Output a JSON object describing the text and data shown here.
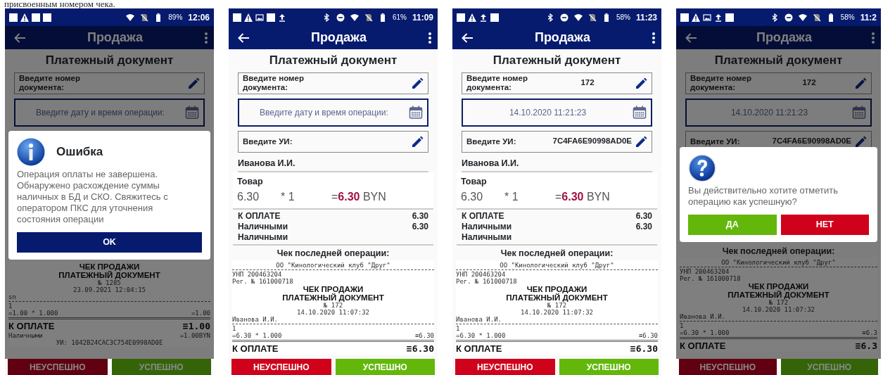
{
  "caption": "присвоенным номером чека.",
  "phones": [
    {
      "dimmed": true,
      "status_bar": {
        "left_icons": [
          {
            "kind": "square"
          },
          {
            "kind": "warning"
          },
          {
            "kind": "square"
          },
          {
            "kind": "square"
          }
        ],
        "right_icons": [
          {
            "kind": "wifi"
          },
          {
            "kind": "nosim"
          },
          {
            "kind": "battery"
          }
        ],
        "battery": "89%",
        "time": "12:06"
      },
      "app_bar": {
        "title": "Продажа"
      },
      "content": [
        {
          "kind": "heading",
          "text": "Платежный документ"
        },
        {
          "kind": "text_field",
          "label": "Введите номер документа:"
        },
        {
          "kind": "date_field",
          "placeholder": "Введите дату и время операции:"
        },
        {
          "kind": "error_dialog",
          "title": "Ошибка",
          "message": "Операция оплаты не завершена. Обнаружено расхождение суммы наличных в БД и СКО. Свяжитесь с оператором ПКС для уточнения состояния операции",
          "buttons": [
            {
              "label": "OK",
              "color": "#061a6e"
            }
          ]
        },
        {
          "kind": "receipt",
          "lines": [
            {
              "kind": "title",
              "text": "ЧЕК ПРОДАЖИ"
            },
            {
              "kind": "title",
              "text": "ПЛАТЕЖНЫЙ ДОКУМЕНТ"
            },
            {
              "kind": "center",
              "text": "№ 1285"
            },
            {
              "kind": "center",
              "text": "23.09.2021 12:04:15"
            },
            {
              "kind": "left",
              "text": "sn"
            },
            {
              "kind": "dashed_rule"
            },
            {
              "kind": "left",
              "text": "1"
            },
            {
              "kind": "pair",
              "text": "=1.00 * 1.000",
              "right": "=1.00"
            },
            {
              "kind": "double_rule"
            },
            {
              "kind": "total",
              "text": "К ОПЛАТЕ",
              "right": "≡1.00"
            },
            {
              "kind": "pair",
              "text": "Наличными",
              "right": "=1.00BYN"
            },
            {
              "kind": "center",
              "text": "УИ: 1042B24CAC3C754E0998AD0E"
            }
          ]
        }
      ],
      "actions": [
        {
          "label": "НЕУСПЕШНО",
          "color": "#600010"
        },
        {
          "label": "УСПЕШНО",
          "color": "#356408"
        }
      ]
    },
    {
      "dimmed": false,
      "status_bar": {
        "left_icons": [
          {
            "kind": "square"
          },
          {
            "kind": "warning"
          },
          {
            "kind": "image"
          },
          {
            "kind": "square"
          },
          {
            "kind": "upload"
          }
        ],
        "right_icons": [
          {
            "kind": "bluetooth"
          },
          {
            "kind": "dnd"
          },
          {
            "kind": "wifi"
          },
          {
            "kind": "nosim"
          },
          {
            "kind": "battery"
          }
        ],
        "battery": "61%",
        "time": "11:09"
      },
      "app_bar": {
        "title": "Продажа"
      },
      "content": [
        {
          "kind": "heading",
          "text": "Платежный документ"
        },
        {
          "kind": "text_field",
          "label": "Введите номер документа:"
        },
        {
          "kind": "date_field",
          "placeholder": "Введите дату и время операции:"
        },
        {
          "kind": "text_field",
          "label": "Введите УИ:"
        },
        {
          "kind": "cashier",
          "text": "Иванова И.И."
        },
        {
          "kind": "item",
          "name": "Товар",
          "price": "6.30",
          "quantity": "* 1",
          "total_sign": "=",
          "total": "6.30",
          "currency": "BYN"
        },
        {
          "kind": "totals",
          "rows": [
            {
              "label": "К ОПЛАТЕ",
              "amount": "6.30"
            },
            {
              "label": "Наличными",
              "amount": "6.30"
            },
            {
              "label": "Наличными"
            }
          ]
        },
        {
          "kind": "subheading",
          "text": "Чек последней операции:"
        },
        {
          "kind": "receipt",
          "lines": [
            {
              "kind": "center",
              "text": "ОО \"Кинологический клуб \"Друг\""
            },
            {
              "kind": "dashed_rule"
            },
            {
              "kind": "left",
              "text": "УНП 200463204"
            },
            {
              "kind": "left",
              "text": "Рег. № 161000718"
            },
            {
              "kind": "title",
              "text": "ЧЕК ПРОДАЖИ"
            },
            {
              "kind": "title",
              "text": "ПЛАТЕЖНЫЙ ДОКУМЕНТ"
            },
            {
              "kind": "center",
              "text": "№ 172"
            },
            {
              "kind": "center",
              "text": "14.10.2020 11:07:32"
            },
            {
              "kind": "left",
              "text": "Иванова И.И."
            },
            {
              "kind": "dashed_rule"
            },
            {
              "kind": "left",
              "text": "1"
            },
            {
              "kind": "pair",
              "text": "=6.30 * 1.000",
              "right": "≡6.30"
            },
            {
              "kind": "double_rule"
            },
            {
              "kind": "total",
              "text": "К ОПЛАТЕ",
              "right": "≡6.30"
            }
          ]
        }
      ],
      "actions": [
        {
          "label": "НЕУСПЕШНО",
          "color": "#d0021b"
        },
        {
          "label": "УСПЕШНО",
          "color": "#63b70b"
        }
      ]
    },
    {
      "dimmed": false,
      "status_bar": {
        "left_icons": [
          {
            "kind": "square"
          },
          {
            "kind": "warning"
          },
          {
            "kind": "upload"
          },
          {
            "kind": "square"
          }
        ],
        "right_icons": [
          {
            "kind": "bluetooth"
          },
          {
            "kind": "dnd"
          },
          {
            "kind": "wifi"
          },
          {
            "kind": "nosim"
          },
          {
            "kind": "battery"
          }
        ],
        "battery": "58%",
        "time": "11:23"
      },
      "app_bar": {
        "title": "Продажа"
      },
      "content": [
        {
          "kind": "heading",
          "text": "Платежный документ"
        },
        {
          "kind": "text_field",
          "label": "Введите номер документа:",
          "value": "172"
        },
        {
          "kind": "date_field",
          "value": "14.10.2020 11:21:23"
        },
        {
          "kind": "text_field",
          "label": "Введите УИ:",
          "value": "7C4FA6E90998AD0E"
        },
        {
          "kind": "cashier",
          "text": "Иванова И.И."
        },
        {
          "kind": "item",
          "name": "Товар",
          "price": "6.30",
          "quantity": "* 1",
          "total_sign": "=",
          "total": "6.30",
          "currency": "BYN"
        },
        {
          "kind": "totals",
          "rows": [
            {
              "label": "К ОПЛАТЕ",
              "amount": "6.30"
            },
            {
              "label": "Наличными",
              "amount": "6.30"
            },
            {
              "label": "Наличными"
            }
          ]
        },
        {
          "kind": "subheading",
          "text": "Чек последней операции:"
        },
        {
          "kind": "receipt",
          "lines": [
            {
              "kind": "center",
              "text": "ОО \"Кинологический клуб \"Друг\""
            },
            {
              "kind": "dashed_rule"
            },
            {
              "kind": "left",
              "text": "УНП 200463204"
            },
            {
              "kind": "left",
              "text": "Рег. № 161000718"
            },
            {
              "kind": "title",
              "text": "ЧЕК ПРОДАЖИ"
            },
            {
              "kind": "title",
              "text": "ПЛАТЕЖНЫЙ ДОКУМЕНТ"
            },
            {
              "kind": "center",
              "text": "№ 172"
            },
            {
              "kind": "center",
              "text": "14.10.2020 11:07:32"
            },
            {
              "kind": "left",
              "text": "Иванова И.И."
            },
            {
              "kind": "dashed_rule"
            },
            {
              "kind": "left",
              "text": "1"
            },
            {
              "kind": "pair",
              "text": "=6.30 * 1.000",
              "right": "≡6.30"
            },
            {
              "kind": "double_rule"
            },
            {
              "kind": "total",
              "text": "К ОПЛАТЕ",
              "right": "≡6.30"
            }
          ]
        }
      ],
      "actions": [
        {
          "label": "НЕУСПЕШНО",
          "color": "#d0021b"
        },
        {
          "label": "УСПЕШНО",
          "color": "#63b70b"
        }
      ]
    },
    {
      "dimmed": true,
      "status_bar": {
        "left_icons": [
          {
            "kind": "square"
          },
          {
            "kind": "warning"
          },
          {
            "kind": "image"
          },
          {
            "kind": "upload"
          },
          {
            "kind": "square"
          }
        ],
        "right_icons": [
          {
            "kind": "bluetooth"
          },
          {
            "kind": "dnd"
          },
          {
            "kind": "wifi"
          },
          {
            "kind": "nosim"
          },
          {
            "kind": "battery"
          }
        ],
        "battery": "58%",
        "time": "11:2"
      },
      "app_bar": {
        "title": "Продажа"
      },
      "content": [
        {
          "kind": "heading",
          "text": "Платежный документ"
        },
        {
          "kind": "text_field",
          "label": "Введите номер документа:",
          "value": "172"
        },
        {
          "kind": "date_field",
          "value": "14.10.2020 11:21:23"
        },
        {
          "kind": "text_field",
          "label": "Введите УИ:",
          "value": "7C4FA6E90998AD0E"
        },
        {
          "kind": "confirm_dialog",
          "message": "Вы действительно хотите отметить операцию как успешную?",
          "buttons": [
            {
              "label": "ДА",
              "color": "#63b70b"
            },
            {
              "label": "НЕТ",
              "color": "#d0021b"
            }
          ]
        },
        {
          "kind": "subheading",
          "text": "Чек последней операции:"
        },
        {
          "kind": "receipt",
          "lines": [
            {
              "kind": "center",
              "text": "ОО \"Кинологический клуб \"Друг\""
            },
            {
              "kind": "dashed_rule"
            },
            {
              "kind": "left",
              "text": "УНП 200463204"
            },
            {
              "kind": "left",
              "text": "Рег. № 161000718"
            },
            {
              "kind": "title",
              "text": "ЧЕК ПРОДАЖИ"
            },
            {
              "kind": "title",
              "text": "ПЛАТЕЖНЫЙ ДОКУМЕНТ"
            },
            {
              "kind": "center",
              "text": "№ 172"
            },
            {
              "kind": "center",
              "text": "14.10.2020 11:07:32"
            },
            {
              "kind": "left",
              "text": "Иванова И.И."
            },
            {
              "kind": "dashed_rule"
            },
            {
              "kind": "left",
              "text": "1"
            },
            {
              "kind": "pair",
              "text": "=6.30 * 1.000",
              "right": "≡6.3"
            },
            {
              "kind": "double_rule"
            },
            {
              "kind": "total",
              "text": "К ОПЛАТЕ",
              "right": "≡6.3"
            }
          ]
        }
      ],
      "actions": [
        {
          "label": "НЕУСПЕШНО",
          "color": "#600010"
        },
        {
          "label": "УСПЕШНО",
          "color": "#356408"
        }
      ]
    }
  ]
}
